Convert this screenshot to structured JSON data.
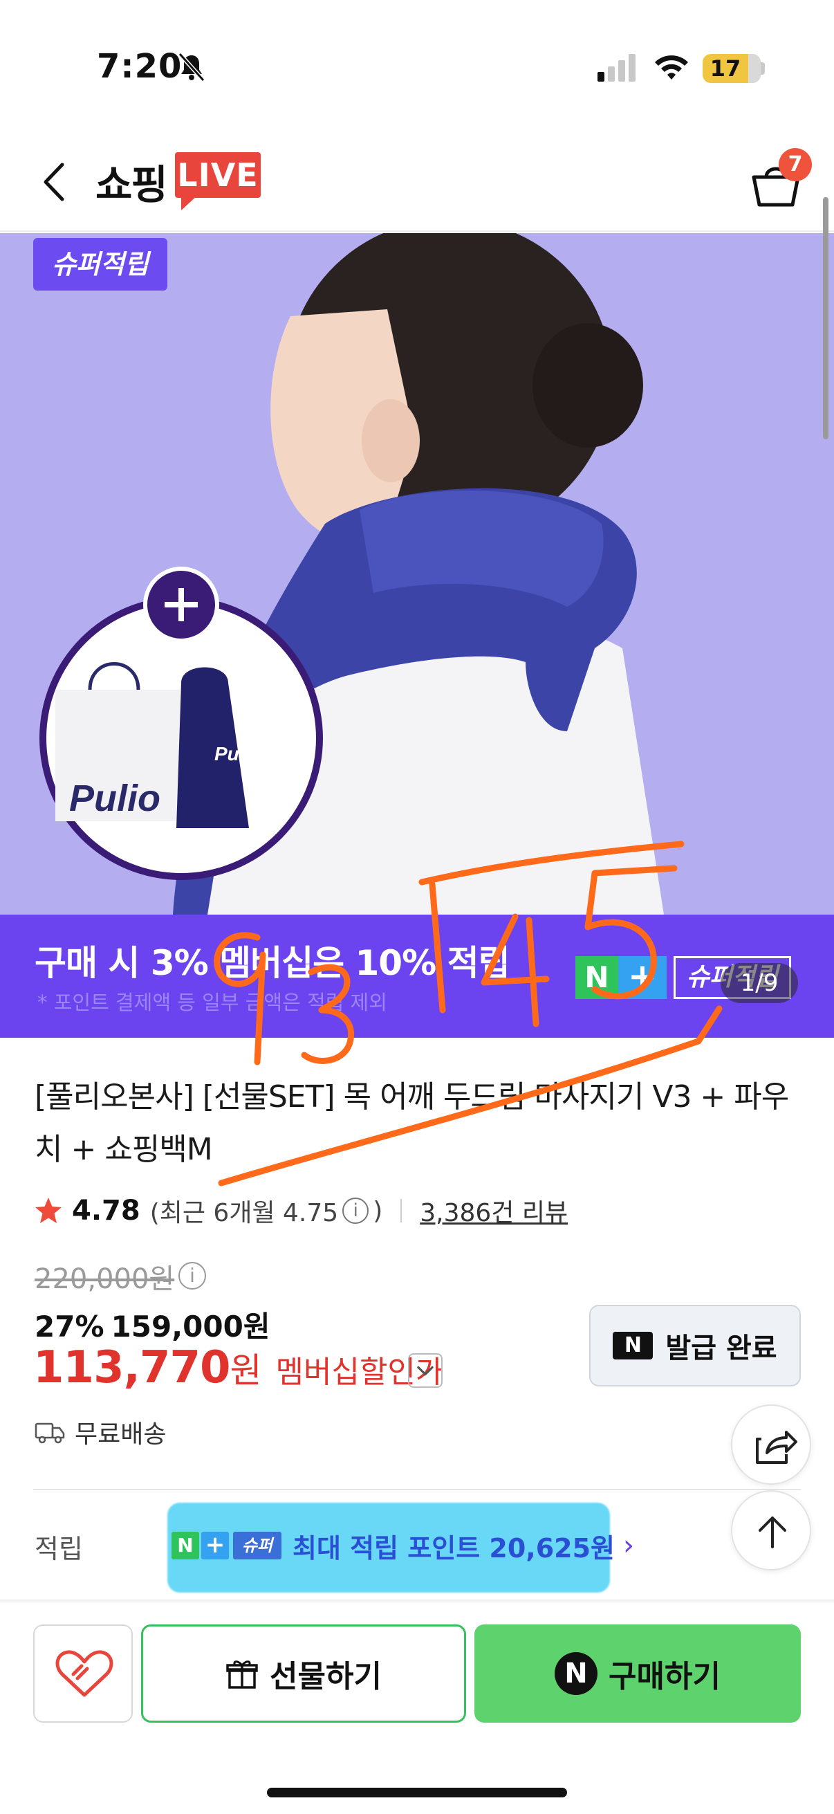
{
  "status_bar": {
    "time": "7:20",
    "battery": "17"
  },
  "header": {
    "logo_text": "쇼핑",
    "live_label": "LIVE",
    "cart_count": "7"
  },
  "hero": {
    "tag": "슈퍼적립",
    "page_counter": "1/9",
    "promo_title": "구매 시 3% 멤버십은 10% 적립",
    "promo_sub": "* 포인트 결제액 등 일부 금액은 적립 제외",
    "badge_n": "N",
    "badge_plus": "+",
    "badge_super": "슈퍼적립",
    "gift_brand": "Pulio",
    "annotation": "93145"
  },
  "product": {
    "title": "[풀리오본사] [선물SET] 목 어깨 두드림 마사지기 V3 + 파우치 + 쇼핑백M",
    "rating": "4.78",
    "rating_recent_open": "(최근 6개월 4.75",
    "rating_recent_close": ")",
    "review_link": "3,386건 리뷰",
    "original_price": "220,000원",
    "discount_rate": "27%",
    "sale_price": "159,000원",
    "member_price": "113,770",
    "member_price_unit": "원",
    "member_label": "멤버십할인가",
    "coupon_n": "N",
    "coupon_label": "발급 완료",
    "shipping": "무료배송",
    "points_label": "적립",
    "points_n": "N",
    "points_plus": "+",
    "points_super": "슈퍼",
    "points_text": "최대 적립 포인트 20,625원",
    "points_chevron": "›"
  },
  "bottom_bar": {
    "gift_label": "선물하기",
    "buy_n": "N",
    "buy_label": "구매하기"
  },
  "colors": {
    "accent_purple": "#6b44f0",
    "price_red": "#e0332d",
    "naver_green": "#5ed36d",
    "live_red": "#e8453c",
    "annotation_orange": "#ff6a1a",
    "highlight_cyan": "#69d8f7"
  },
  "icons": [
    "bell-slash-icon",
    "signal-icon",
    "wifi-icon",
    "back-chevron-icon",
    "cart-icon",
    "star-icon",
    "info-icon",
    "chevron-down-icon",
    "truck-icon",
    "share-icon",
    "arrow-up-icon",
    "heart-icon",
    "gift-icon"
  ]
}
